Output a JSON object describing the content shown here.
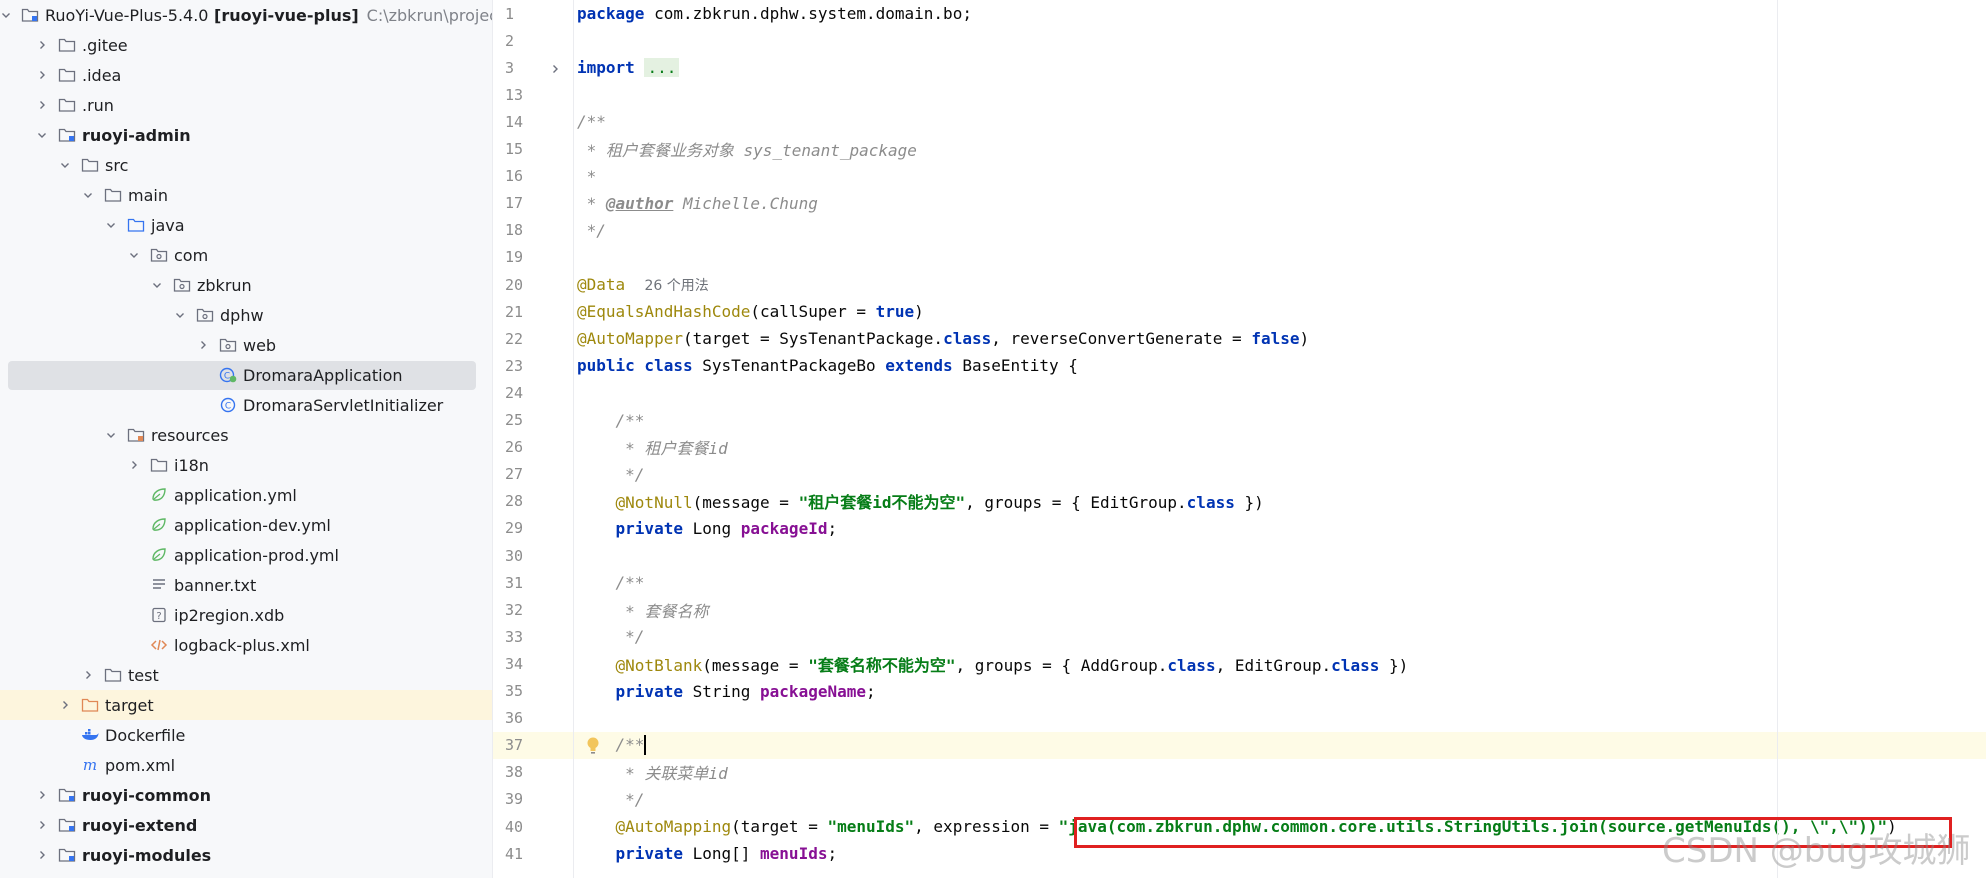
{
  "project_tree": {
    "items": [
      {
        "label": "RuoYi-Vue-Plus-5.4.0 [ruoyi-vue-plus]",
        "path": "C:\\zbkrun\\project\\Ja",
        "indent": 0,
        "expanded": true,
        "icon": "module-folder-icon",
        "bold": false
      },
      {
        "label": ".gitee",
        "indent": 1,
        "expanded": false,
        "icon": "folder-icon"
      },
      {
        "label": ".idea",
        "indent": 1,
        "expanded": false,
        "icon": "folder-icon"
      },
      {
        "label": ".run",
        "indent": 1,
        "expanded": false,
        "icon": "folder-icon"
      },
      {
        "label": "ruoyi-admin",
        "indent": 1,
        "expanded": true,
        "icon": "module-folder-icon",
        "bold": true
      },
      {
        "label": "src",
        "indent": 2,
        "expanded": true,
        "icon": "folder-icon"
      },
      {
        "label": "main",
        "indent": 3,
        "expanded": true,
        "icon": "folder-icon"
      },
      {
        "label": "java",
        "indent": 4,
        "expanded": true,
        "icon": "source-folder-icon"
      },
      {
        "label": "com",
        "indent": 5,
        "expanded": true,
        "icon": "package-icon"
      },
      {
        "label": "zbkrun",
        "indent": 6,
        "expanded": true,
        "icon": "package-icon"
      },
      {
        "label": "dphw",
        "indent": 7,
        "expanded": true,
        "icon": "package-icon"
      },
      {
        "label": "web",
        "indent": 8,
        "expanded": false,
        "icon": "package-icon"
      },
      {
        "label": "DromaraApplication",
        "indent": 8,
        "leaf": true,
        "icon": "spring-class-icon",
        "selected": true
      },
      {
        "label": "DromaraServletInitializer",
        "indent": 8,
        "leaf": true,
        "icon": "class-icon"
      },
      {
        "label": "resources",
        "indent": 4,
        "expanded": true,
        "icon": "resources-folder-icon"
      },
      {
        "label": "i18n",
        "indent": 5,
        "expanded": false,
        "icon": "folder-icon"
      },
      {
        "label": "application.yml",
        "indent": 5,
        "leaf": true,
        "icon": "spring-yml-icon"
      },
      {
        "label": "application-dev.yml",
        "indent": 5,
        "leaf": true,
        "icon": "spring-yml-icon"
      },
      {
        "label": "application-prod.yml",
        "indent": 5,
        "leaf": true,
        "icon": "spring-yml-icon"
      },
      {
        "label": "banner.txt",
        "indent": 5,
        "leaf": true,
        "icon": "text-file-icon"
      },
      {
        "label": "ip2region.xdb",
        "indent": 5,
        "leaf": true,
        "icon": "unknown-file-icon"
      },
      {
        "label": "logback-plus.xml",
        "indent": 5,
        "leaf": true,
        "icon": "xml-file-icon"
      },
      {
        "label": "test",
        "indent": 3,
        "expanded": false,
        "icon": "folder-icon"
      },
      {
        "label": "target",
        "indent": 2,
        "expanded": false,
        "icon": "excluded-folder-icon",
        "highlight": true
      },
      {
        "label": "Dockerfile",
        "indent": 2,
        "leaf": true,
        "icon": "docker-icon"
      },
      {
        "label": "pom.xml",
        "indent": 2,
        "leaf": true,
        "icon": "maven-icon"
      },
      {
        "label": "ruoyi-common",
        "indent": 1,
        "expanded": false,
        "icon": "module-folder-icon",
        "bold": true
      },
      {
        "label": "ruoyi-extend",
        "indent": 1,
        "expanded": false,
        "icon": "module-folder-icon",
        "bold": true
      },
      {
        "label": "ruoyi-modules",
        "indent": 1,
        "expanded": false,
        "icon": "module-folder-icon",
        "bold": true
      }
    ]
  },
  "editor": {
    "current_line": 37,
    "lines": [
      {
        "n": "1",
        "tokens": [
          [
            "kw",
            "package"
          ],
          [
            "plain",
            " com.zbkrun.dphw.system.domain.bo;"
          ]
        ]
      },
      {
        "n": "2",
        "tokens": []
      },
      {
        "n": "3",
        "fold": true,
        "tokens": [
          [
            "kw",
            "import"
          ],
          [
            "plain",
            " "
          ],
          [
            "fold",
            "..."
          ]
        ]
      },
      {
        "n": "13",
        "tokens": []
      },
      {
        "n": "14",
        "tokens": [
          [
            "com",
            "/**"
          ]
        ]
      },
      {
        "n": "15",
        "tokens": [
          [
            "com",
            " * 租户套餐业务对象 sys_tenant_package"
          ]
        ]
      },
      {
        "n": "16",
        "tokens": [
          [
            "com",
            " *"
          ]
        ]
      },
      {
        "n": "17",
        "tokens": [
          [
            "com",
            " * "
          ],
          [
            "tag",
            "@author"
          ],
          [
            "com",
            " Michelle.Chung"
          ]
        ]
      },
      {
        "n": "18",
        "tokens": [
          [
            "com",
            " */"
          ]
        ]
      },
      {
        "n": "19",
        "tokens": []
      },
      {
        "n": "20",
        "tokens": [
          [
            "ann",
            "@Data"
          ],
          [
            "plain",
            "  "
          ],
          [
            "hint",
            "26 个用法"
          ]
        ]
      },
      {
        "n": "21",
        "tokens": [
          [
            "ann",
            "@EqualsAndHashCode"
          ],
          [
            "plain",
            "(callSuper = "
          ],
          [
            "kw",
            "true"
          ],
          [
            "plain",
            ")"
          ]
        ]
      },
      {
        "n": "22",
        "tokens": [
          [
            "ann",
            "@AutoMapper"
          ],
          [
            "plain",
            "(target = SysTenantPackage."
          ],
          [
            "kw",
            "class"
          ],
          [
            "plain",
            ", reverseConvertGenerate = "
          ],
          [
            "kw",
            "false"
          ],
          [
            "plain",
            ")"
          ]
        ]
      },
      {
        "n": "23",
        "tokens": [
          [
            "kw",
            "public class"
          ],
          [
            "plain",
            " SysTenantPackageBo "
          ],
          [
            "kw",
            "extends"
          ],
          [
            "plain",
            " BaseEntity {"
          ]
        ]
      },
      {
        "n": "24",
        "tokens": []
      },
      {
        "n": "25",
        "tokens": [
          [
            "plain",
            "    "
          ],
          [
            "com",
            "/**"
          ]
        ]
      },
      {
        "n": "26",
        "tokens": [
          [
            "plain",
            "    "
          ],
          [
            "com",
            " * 租户套餐id"
          ]
        ]
      },
      {
        "n": "27",
        "tokens": [
          [
            "plain",
            "    "
          ],
          [
            "com",
            " */"
          ]
        ]
      },
      {
        "n": "28",
        "tokens": [
          [
            "plain",
            "    "
          ],
          [
            "ann",
            "@NotNull"
          ],
          [
            "plain",
            "(message = "
          ],
          [
            "str",
            "\"租户套餐id不能为空\""
          ],
          [
            "plain",
            ", groups = { EditGroup."
          ],
          [
            "kw",
            "class"
          ],
          [
            "plain",
            " })"
          ]
        ]
      },
      {
        "n": "29",
        "tokens": [
          [
            "plain",
            "    "
          ],
          [
            "kw",
            "private"
          ],
          [
            "plain",
            " Long "
          ],
          [
            "field",
            "packageId"
          ],
          [
            "plain",
            ";"
          ]
        ]
      },
      {
        "n": "30",
        "tokens": []
      },
      {
        "n": "31",
        "tokens": [
          [
            "plain",
            "    "
          ],
          [
            "com",
            "/**"
          ]
        ]
      },
      {
        "n": "32",
        "tokens": [
          [
            "plain",
            "    "
          ],
          [
            "com",
            " * 套餐名称"
          ]
        ]
      },
      {
        "n": "33",
        "tokens": [
          [
            "plain",
            "    "
          ],
          [
            "com",
            " */"
          ]
        ]
      },
      {
        "n": "34",
        "tokens": [
          [
            "plain",
            "    "
          ],
          [
            "ann",
            "@NotBlank"
          ],
          [
            "plain",
            "(message = "
          ],
          [
            "str",
            "\"套餐名称不能为空\""
          ],
          [
            "plain",
            ", groups = { AddGroup."
          ],
          [
            "kw",
            "class"
          ],
          [
            "plain",
            ", EditGroup."
          ],
          [
            "kw",
            "class"
          ],
          [
            "plain",
            " })"
          ]
        ]
      },
      {
        "n": "35",
        "tokens": [
          [
            "plain",
            "    "
          ],
          [
            "kw",
            "private"
          ],
          [
            "plain",
            " String "
          ],
          [
            "field",
            "packageName"
          ],
          [
            "plain",
            ";"
          ]
        ]
      },
      {
        "n": "36",
        "tokens": []
      },
      {
        "n": "37",
        "bulb": true,
        "caret": true,
        "tokens": [
          [
            "plain",
            "    "
          ],
          [
            "com",
            "/**"
          ]
        ]
      },
      {
        "n": "38",
        "tokens": [
          [
            "plain",
            "    "
          ],
          [
            "com",
            " * 关联菜单id"
          ]
        ]
      },
      {
        "n": "39",
        "tokens": [
          [
            "plain",
            "    "
          ],
          [
            "com",
            " */"
          ]
        ]
      },
      {
        "n": "40",
        "tokens": [
          [
            "plain",
            "    "
          ],
          [
            "ann",
            "@AutoMapping"
          ],
          [
            "plain",
            "(target = "
          ],
          [
            "str",
            "\"menuIds\""
          ],
          [
            "plain",
            ", expression = "
          ],
          [
            "str",
            "\"java(com.zbkrun.dphw.common.core.utils.StringUtils.join(source.getMenuIds(), \\\",\\\"))\""
          ],
          [
            "plain",
            ")"
          ]
        ]
      },
      {
        "n": "41",
        "tokens": [
          [
            "plain",
            "    "
          ],
          [
            "kw",
            "private"
          ],
          [
            "plain",
            " Long[] "
          ],
          [
            "field",
            "menuIds"
          ],
          [
            "plain",
            ";"
          ]
        ]
      }
    ]
  },
  "watermark": "CSDN @bug攻城狮",
  "colors": {
    "keyword": "#0033b3",
    "comment": "#8c8c8c",
    "annotation": "#9e880d",
    "string": "#067d17",
    "field": "#871094",
    "highlight_box": "#e02020"
  }
}
